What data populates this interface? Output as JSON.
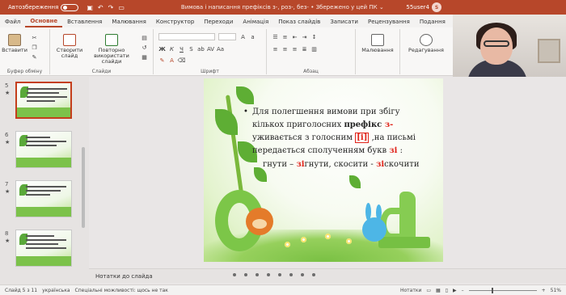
{
  "titlebar": {
    "autosave_label": "Автозбереження",
    "doc_title": "Вимова і написання префіксів з-, роз-, без-",
    "saved_status": "Збережено у цей ПК",
    "user": "55user4"
  },
  "tabs": [
    "Файл",
    "Основне",
    "Вставлення",
    "Малювання",
    "Конструктор",
    "Переходи",
    "Анімація",
    "Показ слайдів",
    "Записати",
    "Рецензування",
    "Подання"
  ],
  "ribbon": {
    "paste_label": "Вставити",
    "clipboard_group": "Буфер обміну",
    "new_slide_label": "Створити слайд",
    "reuse_label": "Повторно використати слайди",
    "slides_group": "Слайди",
    "font_group": "Шрифт",
    "paragraph_group": "Абзац",
    "drawing_label": "Малювання",
    "editing_label": "Редагування"
  },
  "thumbnails": [
    {
      "num": "5",
      "star": "★",
      "selected": true
    },
    {
      "num": "6",
      "star": "★",
      "selected": false
    },
    {
      "num": "7",
      "star": "★",
      "selected": false
    },
    {
      "num": "8",
      "star": "★",
      "selected": false
    }
  ],
  "slide": {
    "bullet": "•",
    "line1": "Для полегшення вимови при збігу",
    "line2_pre": "кількох приголосних ",
    "line2_bold": "префікс",
    "line2_red": " з-",
    "line3_pre": "уживається з голосним ",
    "line3_box": "[і]",
    "line3_post": " ,на письмі",
    "line4_pre": "передається сполученням букв ",
    "line4_red": "зі",
    "line4_post": " :",
    "ex_a": "гнути – ",
    "ex_b": "зі",
    "ex_c": "гнути, скосити - ",
    "ex_d": "зі",
    "ex_e": "скочити"
  },
  "notes_label": "Нотатки до слайда",
  "status": {
    "slide_count": "Слайд 5 з 11",
    "language": "українська",
    "accessibility": "Спеціальні можливості: щось не так",
    "notes_btn": "Нотатки",
    "zoom": "51%"
  },
  "colors": {
    "accent": "#b7472a",
    "highlight_red": "#e0241b"
  }
}
